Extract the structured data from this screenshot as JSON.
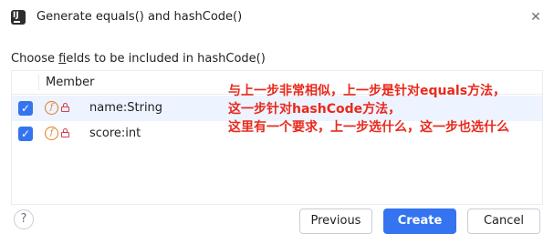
{
  "window": {
    "title": "Generate equals() and hashCode()",
    "app_icon_text": "IJ",
    "close_glyph": "✕"
  },
  "prompt": {
    "before": "Choose ",
    "underlined": "f",
    "after": "ields to be included in hashCode()"
  },
  "list": {
    "column_header": "Member",
    "rows": [
      {
        "checked": true,
        "icon": "field-icon",
        "lock": "lock-icon",
        "label": "name:String",
        "selected": true
      },
      {
        "checked": true,
        "icon": "field-icon",
        "lock": "lock-icon",
        "label": "score:int",
        "selected": false
      }
    ]
  },
  "annotation": {
    "lines": [
      "与上一步非常相似，上一步是针对equals方法，",
      "这一步针对hashCode方法，",
      "这里有一个要求，上一步选什么，这一步也选什么"
    ],
    "color": "#e8291c"
  },
  "footer": {
    "help_glyph": "?",
    "previous_label": "Previous",
    "create_label": "Create",
    "cancel_label": "Cancel"
  },
  "colors": {
    "accent": "#3574f0",
    "selected_row": "#edf3ff",
    "field_icon": "#e07d1f",
    "lock_icon": "#db3b4b"
  }
}
